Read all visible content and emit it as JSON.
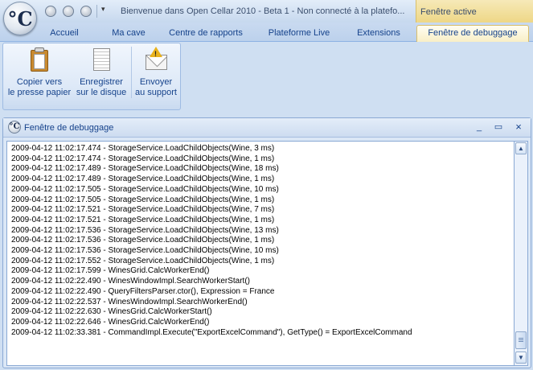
{
  "window": {
    "title": "Bienvenue dans Open Cellar 2010 - Beta 1 - Non connecté à la platefo...",
    "context_tab_header": "Fenêtre active",
    "app_logo": "°C"
  },
  "tabs": [
    {
      "label": "Accueil"
    },
    {
      "label": "Ma cave"
    },
    {
      "label": "Centre de rapports"
    },
    {
      "label": "Plateforme Live"
    },
    {
      "label": "Extensions"
    },
    {
      "label": "Fenêtre de debuggage",
      "active": true
    }
  ],
  "ribbon": {
    "buttons": [
      {
        "line1": "Copier vers",
        "line2": "le presse papier",
        "icon": "clipboard-icon"
      },
      {
        "line1": "Enregistrer",
        "line2": "sur le disque",
        "icon": "document-save-icon"
      },
      {
        "line1": "Envoyer",
        "line2": "au support",
        "icon": "envelope-warning-icon"
      }
    ]
  },
  "debug_window": {
    "title": "Fenêtre de debuggage",
    "buttons": {
      "minimize": "_",
      "maximize": "▭",
      "close": "×"
    },
    "log_lines": [
      "2009-04-12 11:02:17.474 - StorageService.LoadChildObjects(Wine, 3 ms)",
      "2009-04-12 11:02:17.474 - StorageService.LoadChildObjects(Wine, 1 ms)",
      "2009-04-12 11:02:17.489 - StorageService.LoadChildObjects(Wine, 18 ms)",
      "2009-04-12 11:02:17.489 - StorageService.LoadChildObjects(Wine, 1 ms)",
      "2009-04-12 11:02:17.505 - StorageService.LoadChildObjects(Wine, 10 ms)",
      "2009-04-12 11:02:17.505 - StorageService.LoadChildObjects(Wine, 1 ms)",
      "2009-04-12 11:02:17.521 - StorageService.LoadChildObjects(Wine, 7 ms)",
      "2009-04-12 11:02:17.521 - StorageService.LoadChildObjects(Wine, 1 ms)",
      "2009-04-12 11:02:17.536 - StorageService.LoadChildObjects(Wine, 13 ms)",
      "2009-04-12 11:02:17.536 - StorageService.LoadChildObjects(Wine, 1 ms)",
      "2009-04-12 11:02:17.536 - StorageService.LoadChildObjects(Wine, 10 ms)",
      "2009-04-12 11:02:17.552 - StorageService.LoadChildObjects(Wine, 1 ms)",
      "2009-04-12 11:02:17.599 - WinesGrid.CalcWorkerEnd()",
      "2009-04-12 11:02:22.490 - WinesWindowImpl.SearchWorkerStart()",
      "2009-04-12 11:02:22.490 - QueryFiltersParser.ctor(), Expression = France",
      "2009-04-12 11:02:22.537 - WinesWindowImpl.SearchWorkerEnd()",
      "2009-04-12 11:02:22.630 - WinesGrid.CalcWorkerStart()",
      "2009-04-12 11:02:22.646 - WinesGrid.CalcWorkerEnd()",
      "2009-04-12 11:02:33.381 - CommandImpl.Execute(\"ExportExcelCommand\"), GetType() = ExportExcelCommand"
    ],
    "scrollbar": {
      "up": "▲",
      "down": "▼"
    }
  }
}
